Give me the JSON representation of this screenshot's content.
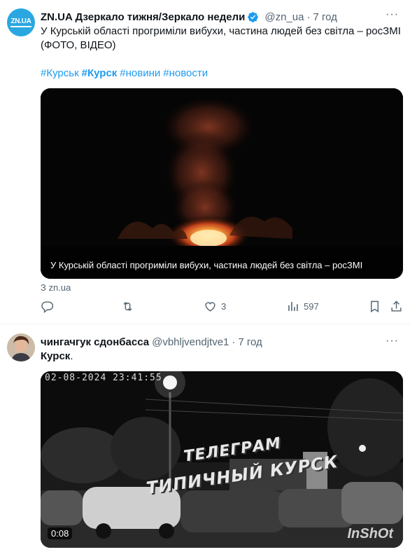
{
  "tweets": [
    {
      "display_name": "ZN.UA Дзеркало тижня/Зеркало недели",
      "handle": "@zn_ua",
      "separator": "·",
      "time": "7 год",
      "avatar_text": "ZN.UA",
      "text": "У Курській області прогриміли вибухи, частина людей без світла – росЗМІ (ФОТО, ВІДЕО)",
      "hashtags": [
        "#Курськ",
        "#Курск",
        "#новини",
        "#новости"
      ],
      "card": {
        "caption": "У Курській області прогриміли вибухи, частина людей без світла – росЗМІ",
        "source": "З zn.ua"
      },
      "actions": {
        "reply": "",
        "retweet": "",
        "like": "3",
        "views": "597"
      }
    },
    {
      "display_name": "чингачгук сдонбасса",
      "handle": "@vbhljvendjtve1",
      "separator": "·",
      "time": "7 год",
      "text": "Курск",
      "text_suffix": ".",
      "video": {
        "timestamp": "02-08-2024 23:41:55",
        "overlay_line1": "ТЕЛЕГРАМ",
        "overlay_line2": "ТИПИЧНЫЙ КУРСК",
        "duration": "0:08",
        "watermark": "InShOt"
      }
    }
  ],
  "colors": {
    "accent": "#1d9bf0",
    "secondary_text": "#536471",
    "brand_zn": "#2aa7e0"
  },
  "icons": [
    "verified-icon",
    "more-icon",
    "reply-icon",
    "retweet-icon",
    "like-icon",
    "views-icon",
    "bookmark-icon",
    "share-icon"
  ]
}
